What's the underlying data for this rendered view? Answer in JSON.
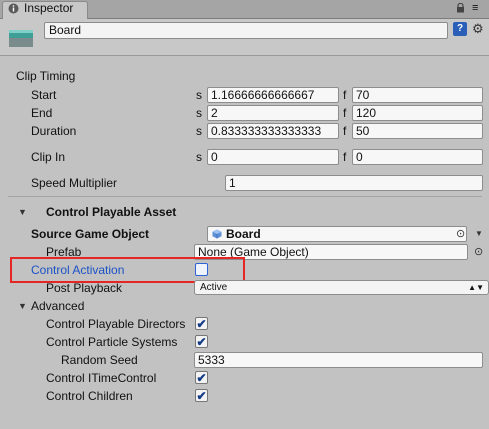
{
  "tab": {
    "title": "Inspector",
    "icon": "info-icon",
    "lock_icon": "lock-icon",
    "menu_icon": "menu-icon"
  },
  "header": {
    "object_name": "Board",
    "help_icon": "help-book-icon",
    "settings_icon": "gear-icon"
  },
  "clip_timing": {
    "title": "Clip Timing",
    "rows": [
      {
        "label": "Start",
        "s_unit": "s",
        "s_value": "1.16666666666667",
        "f_unit": "f",
        "f_value": "70"
      },
      {
        "label": "End",
        "s_unit": "s",
        "s_value": "2",
        "f_unit": "f",
        "f_value": "120"
      },
      {
        "label": "Duration",
        "s_unit": "s",
        "s_value": "0.833333333333333",
        "f_unit": "f",
        "f_value": "50"
      },
      {
        "label": "Clip In",
        "s_unit": "s",
        "s_value": "0",
        "f_unit": "f",
        "f_value": "0"
      }
    ],
    "speed_multiplier": {
      "label": "Speed Multiplier",
      "value": "1"
    }
  },
  "control_playable_asset": {
    "title": "Control Playable Asset",
    "source_game_object": {
      "label": "Source Game Object",
      "value": "Board"
    },
    "prefab": {
      "label": "Prefab",
      "value": "None (Game Object)"
    },
    "control_activation": {
      "label": "Control Activation",
      "checked": false
    },
    "post_playback": {
      "label": "Post Playback",
      "value": "Active"
    },
    "advanced": {
      "title": "Advanced",
      "control_playable_directors": {
        "label": "Control Playable Directors",
        "checked": true
      },
      "control_particle_systems": {
        "label": "Control Particle Systems",
        "checked": true
      },
      "random_seed": {
        "label": "Random Seed",
        "value": "5333"
      },
      "control_itimecontrol": {
        "label": "Control ITimeControl",
        "checked": true
      },
      "control_children": {
        "label": "Control Children",
        "checked": true
      }
    }
  },
  "colors": {
    "background": "#c2c2c2",
    "link_blue": "#1a52c6",
    "highlight_red": "#e82525"
  }
}
